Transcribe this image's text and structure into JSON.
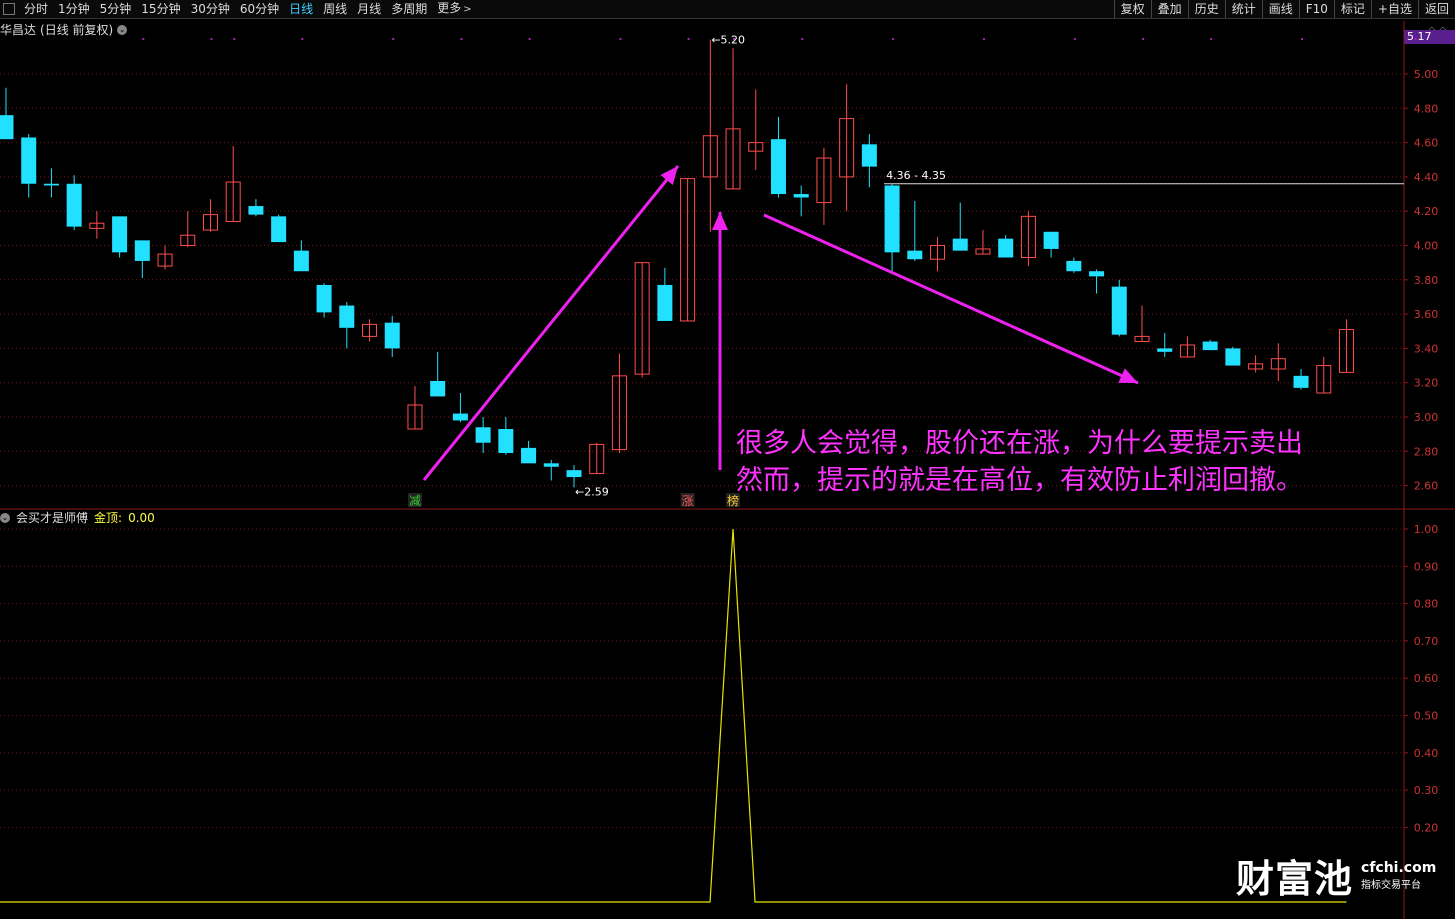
{
  "toolbar": {
    "periods": [
      {
        "label": "分时",
        "active": false
      },
      {
        "label": "1分钟",
        "active": false
      },
      {
        "label": "5分钟",
        "active": false
      },
      {
        "label": "15分钟",
        "active": false
      },
      {
        "label": "30分钟",
        "active": false
      },
      {
        "label": "60分钟",
        "active": false
      },
      {
        "label": "日线",
        "active": true
      },
      {
        "label": "周线",
        "active": false
      },
      {
        "label": "月线",
        "active": false
      },
      {
        "label": "多周期",
        "active": false
      },
      {
        "label": "更多",
        "active": false
      }
    ],
    "more_chevron": ">",
    "tools": [
      "复权",
      "叠加",
      "历史",
      "统计",
      "画线",
      "F10",
      "标记",
      "+自选",
      "返回"
    ]
  },
  "stock": {
    "name": "华昌达",
    "mode": "(日线 前复权)"
  },
  "right_icons": "◇ ◇",
  "price_tag": "5.17",
  "indicator": {
    "name": "会买才是师傅",
    "label": "金顶:",
    "value": "0.00"
  },
  "annotation": {
    "line1": "很多人会觉得，股价还在涨，为什么要提示卖出",
    "line2": "然而，提示的就是在高位，有效防止利润回撤。"
  },
  "logo": {
    "big": "财富池",
    "url": "cfchi.com",
    "sub": "指标交易平台"
  },
  "chart_data": {
    "type": "candlestick",
    "colors": {
      "up": "#ff4d4d",
      "down": "#22e0ff",
      "indicator": "#e6e600",
      "arrow": "#ee22ee",
      "grid_price": "#7a1414",
      "grid_ind": "#6a1010",
      "marker_dot": "#aa22aa"
    },
    "price_axis": {
      "ylim": [
        2.5,
        5.3
      ],
      "ticks": [
        "5.00",
        "4.80",
        "4.60",
        "4.40",
        "4.20",
        "4.00",
        "3.80",
        "3.60",
        "3.40",
        "3.20",
        "3.00",
        "2.80",
        "2.60"
      ]
    },
    "indicator_axis": {
      "ylim": [
        0,
        1.05
      ],
      "ticks": [
        "1.00",
        "0.90",
        "0.80",
        "0.70",
        "0.60",
        "0.50",
        "0.40",
        "0.30",
        "0.20"
      ]
    },
    "candles": [
      {
        "o": 4.76,
        "c": 4.62,
        "h": 4.92,
        "l": 4.62
      },
      {
        "o": 4.63,
        "c": 4.36,
        "h": 4.65,
        "l": 4.28
      },
      {
        "o": 4.36,
        "c": 4.35,
        "h": 4.45,
        "l": 4.28
      },
      {
        "o": 4.36,
        "c": 4.11,
        "h": 4.41,
        "l": 4.09
      },
      {
        "o": 4.1,
        "c": 4.13,
        "h": 4.2,
        "l": 4.04
      },
      {
        "o": 4.17,
        "c": 3.96,
        "h": 4.17,
        "l": 3.93
      },
      {
        "o": 4.03,
        "c": 3.91,
        "h": 4.03,
        "l": 3.81
      },
      {
        "o": 3.88,
        "c": 3.95,
        "h": 4.0,
        "l": 3.86
      },
      {
        "o": 4.0,
        "c": 4.06,
        "h": 4.2,
        "l": 3.99
      },
      {
        "o": 4.09,
        "c": 4.18,
        "h": 4.27,
        "l": 4.08
      },
      {
        "o": 4.14,
        "c": 4.37,
        "h": 4.58,
        "l": 4.14
      },
      {
        "o": 4.23,
        "c": 4.18,
        "h": 4.27,
        "l": 4.17
      },
      {
        "o": 4.17,
        "c": 4.02,
        "h": 4.18,
        "l": 4.02
      },
      {
        "o": 3.97,
        "c": 3.85,
        "h": 4.03,
        "l": 3.85
      },
      {
        "o": 3.77,
        "c": 3.61,
        "h": 3.78,
        "l": 3.58
      },
      {
        "o": 3.65,
        "c": 3.52,
        "h": 3.67,
        "l": 3.4
      },
      {
        "o": 3.47,
        "c": 3.54,
        "h": 3.57,
        "l": 3.44
      },
      {
        "o": 3.55,
        "c": 3.4,
        "h": 3.59,
        "l": 3.35
      },
      {
        "o": 2.93,
        "c": 3.07,
        "h": 3.18,
        "l": 2.93
      },
      {
        "o": 3.21,
        "c": 3.12,
        "h": 3.38,
        "l": 3.12
      },
      {
        "o": 3.02,
        "c": 2.98,
        "h": 3.14,
        "l": 2.97
      },
      {
        "o": 2.94,
        "c": 2.85,
        "h": 3.0,
        "l": 2.79
      },
      {
        "o": 2.93,
        "c": 2.79,
        "h": 3.0,
        "l": 2.78
      },
      {
        "o": 2.82,
        "c": 2.73,
        "h": 2.86,
        "l": 2.73
      },
      {
        "o": 2.73,
        "c": 2.71,
        "h": 2.75,
        "l": 2.63
      },
      {
        "o": 2.69,
        "c": 2.65,
        "h": 2.72,
        "l": 2.59
      },
      {
        "o": 2.67,
        "c": 2.84,
        "h": 2.85,
        "l": 2.67
      },
      {
        "o": 2.81,
        "c": 3.24,
        "h": 3.37,
        "l": 2.79
      },
      {
        "o": 3.25,
        "c": 3.9,
        "h": 3.9,
        "l": 3.23
      },
      {
        "o": 3.77,
        "c": 3.56,
        "h": 3.87,
        "l": 3.56
      },
      {
        "o": 3.56,
        "c": 4.39,
        "h": 4.39,
        "l": 3.56
      },
      {
        "o": 4.4,
        "c": 4.64,
        "h": 5.2,
        "l": 4.08
      },
      {
        "o": 4.33,
        "c": 4.68,
        "h": 5.15,
        "l": 4.33
      },
      {
        "o": 4.55,
        "c": 4.6,
        "h": 4.91,
        "l": 4.44
      },
      {
        "o": 4.62,
        "c": 4.3,
        "h": 4.75,
        "l": 4.28
      },
      {
        "o": 4.3,
        "c": 4.28,
        "h": 4.35,
        "l": 4.17
      },
      {
        "o": 4.25,
        "c": 4.51,
        "h": 4.57,
        "l": 4.12
      },
      {
        "o": 4.4,
        "c": 4.74,
        "h": 4.94,
        "l": 4.2
      },
      {
        "o": 4.59,
        "c": 4.46,
        "h": 4.65,
        "l": 4.34
      },
      {
        "o": 4.35,
        "c": 3.96,
        "h": 4.36,
        "l": 3.84
      },
      {
        "o": 3.97,
        "c": 3.92,
        "h": 4.26,
        "l": 3.91
      },
      {
        "o": 3.92,
        "c": 4.0,
        "h": 4.05,
        "l": 3.85
      },
      {
        "o": 4.04,
        "c": 3.97,
        "h": 4.25,
        "l": 3.97
      },
      {
        "o": 3.95,
        "c": 3.98,
        "h": 4.09,
        "l": 3.95
      },
      {
        "o": 4.04,
        "c": 3.93,
        "h": 4.06,
        "l": 3.93
      },
      {
        "o": 3.93,
        "c": 4.17,
        "h": 4.2,
        "l": 3.88
      },
      {
        "o": 4.08,
        "c": 3.98,
        "h": 4.08,
        "l": 3.93
      },
      {
        "o": 3.91,
        "c": 3.85,
        "h": 3.93,
        "l": 3.84
      },
      {
        "o": 3.85,
        "c": 3.82,
        "h": 3.86,
        "l": 3.72
      },
      {
        "o": 3.76,
        "c": 3.48,
        "h": 3.8,
        "l": 3.47
      },
      {
        "o": 3.44,
        "c": 3.47,
        "h": 3.65,
        "l": 3.44
      },
      {
        "o": 3.4,
        "c": 3.38,
        "h": 3.49,
        "l": 3.35
      },
      {
        "o": 3.35,
        "c": 3.42,
        "h": 3.47,
        "l": 3.35
      },
      {
        "o": 3.44,
        "c": 3.39,
        "h": 3.45,
        "l": 3.39
      },
      {
        "o": 3.4,
        "c": 3.3,
        "h": 3.41,
        "l": 3.3
      },
      {
        "o": 3.28,
        "c": 3.31,
        "h": 3.36,
        "l": 3.26
      },
      {
        "o": 3.28,
        "c": 3.34,
        "h": 3.43,
        "l": 3.21
      },
      {
        "o": 3.24,
        "c": 3.17,
        "h": 3.28,
        "l": 3.16
      },
      {
        "o": 3.14,
        "c": 3.3,
        "h": 3.35,
        "l": 3.14
      },
      {
        "o": 3.26,
        "c": 3.51,
        "h": 3.57,
        "l": 3.26
      }
    ],
    "labels": [
      {
        "text": "5.20",
        "candle": 31,
        "price": 5.2,
        "arrow": "←"
      },
      {
        "text": "2.59",
        "candle": 25,
        "price": 2.59,
        "arrow": "←"
      }
    ],
    "range_label": "4.36 - 4.35",
    "range_value": 4.36,
    "range_from_candle": 39,
    "markers": [
      {
        "text": "减",
        "candle": 18,
        "color": "#33cc33"
      },
      {
        "text": "涨",
        "candle": 30,
        "color": "#ff5555"
      },
      {
        "text": "榜",
        "candle": 32,
        "color": "#ffcc33"
      }
    ],
    "top_dots_candles": [
      6,
      9,
      10,
      13,
      17,
      20,
      23,
      27,
      30,
      32,
      35,
      39,
      43,
      47,
      50,
      53,
      57,
      62
    ],
    "indicator_values_spike": {
      "candle": 32,
      "value": 1.0
    },
    "indicator_baseline": 0
  }
}
